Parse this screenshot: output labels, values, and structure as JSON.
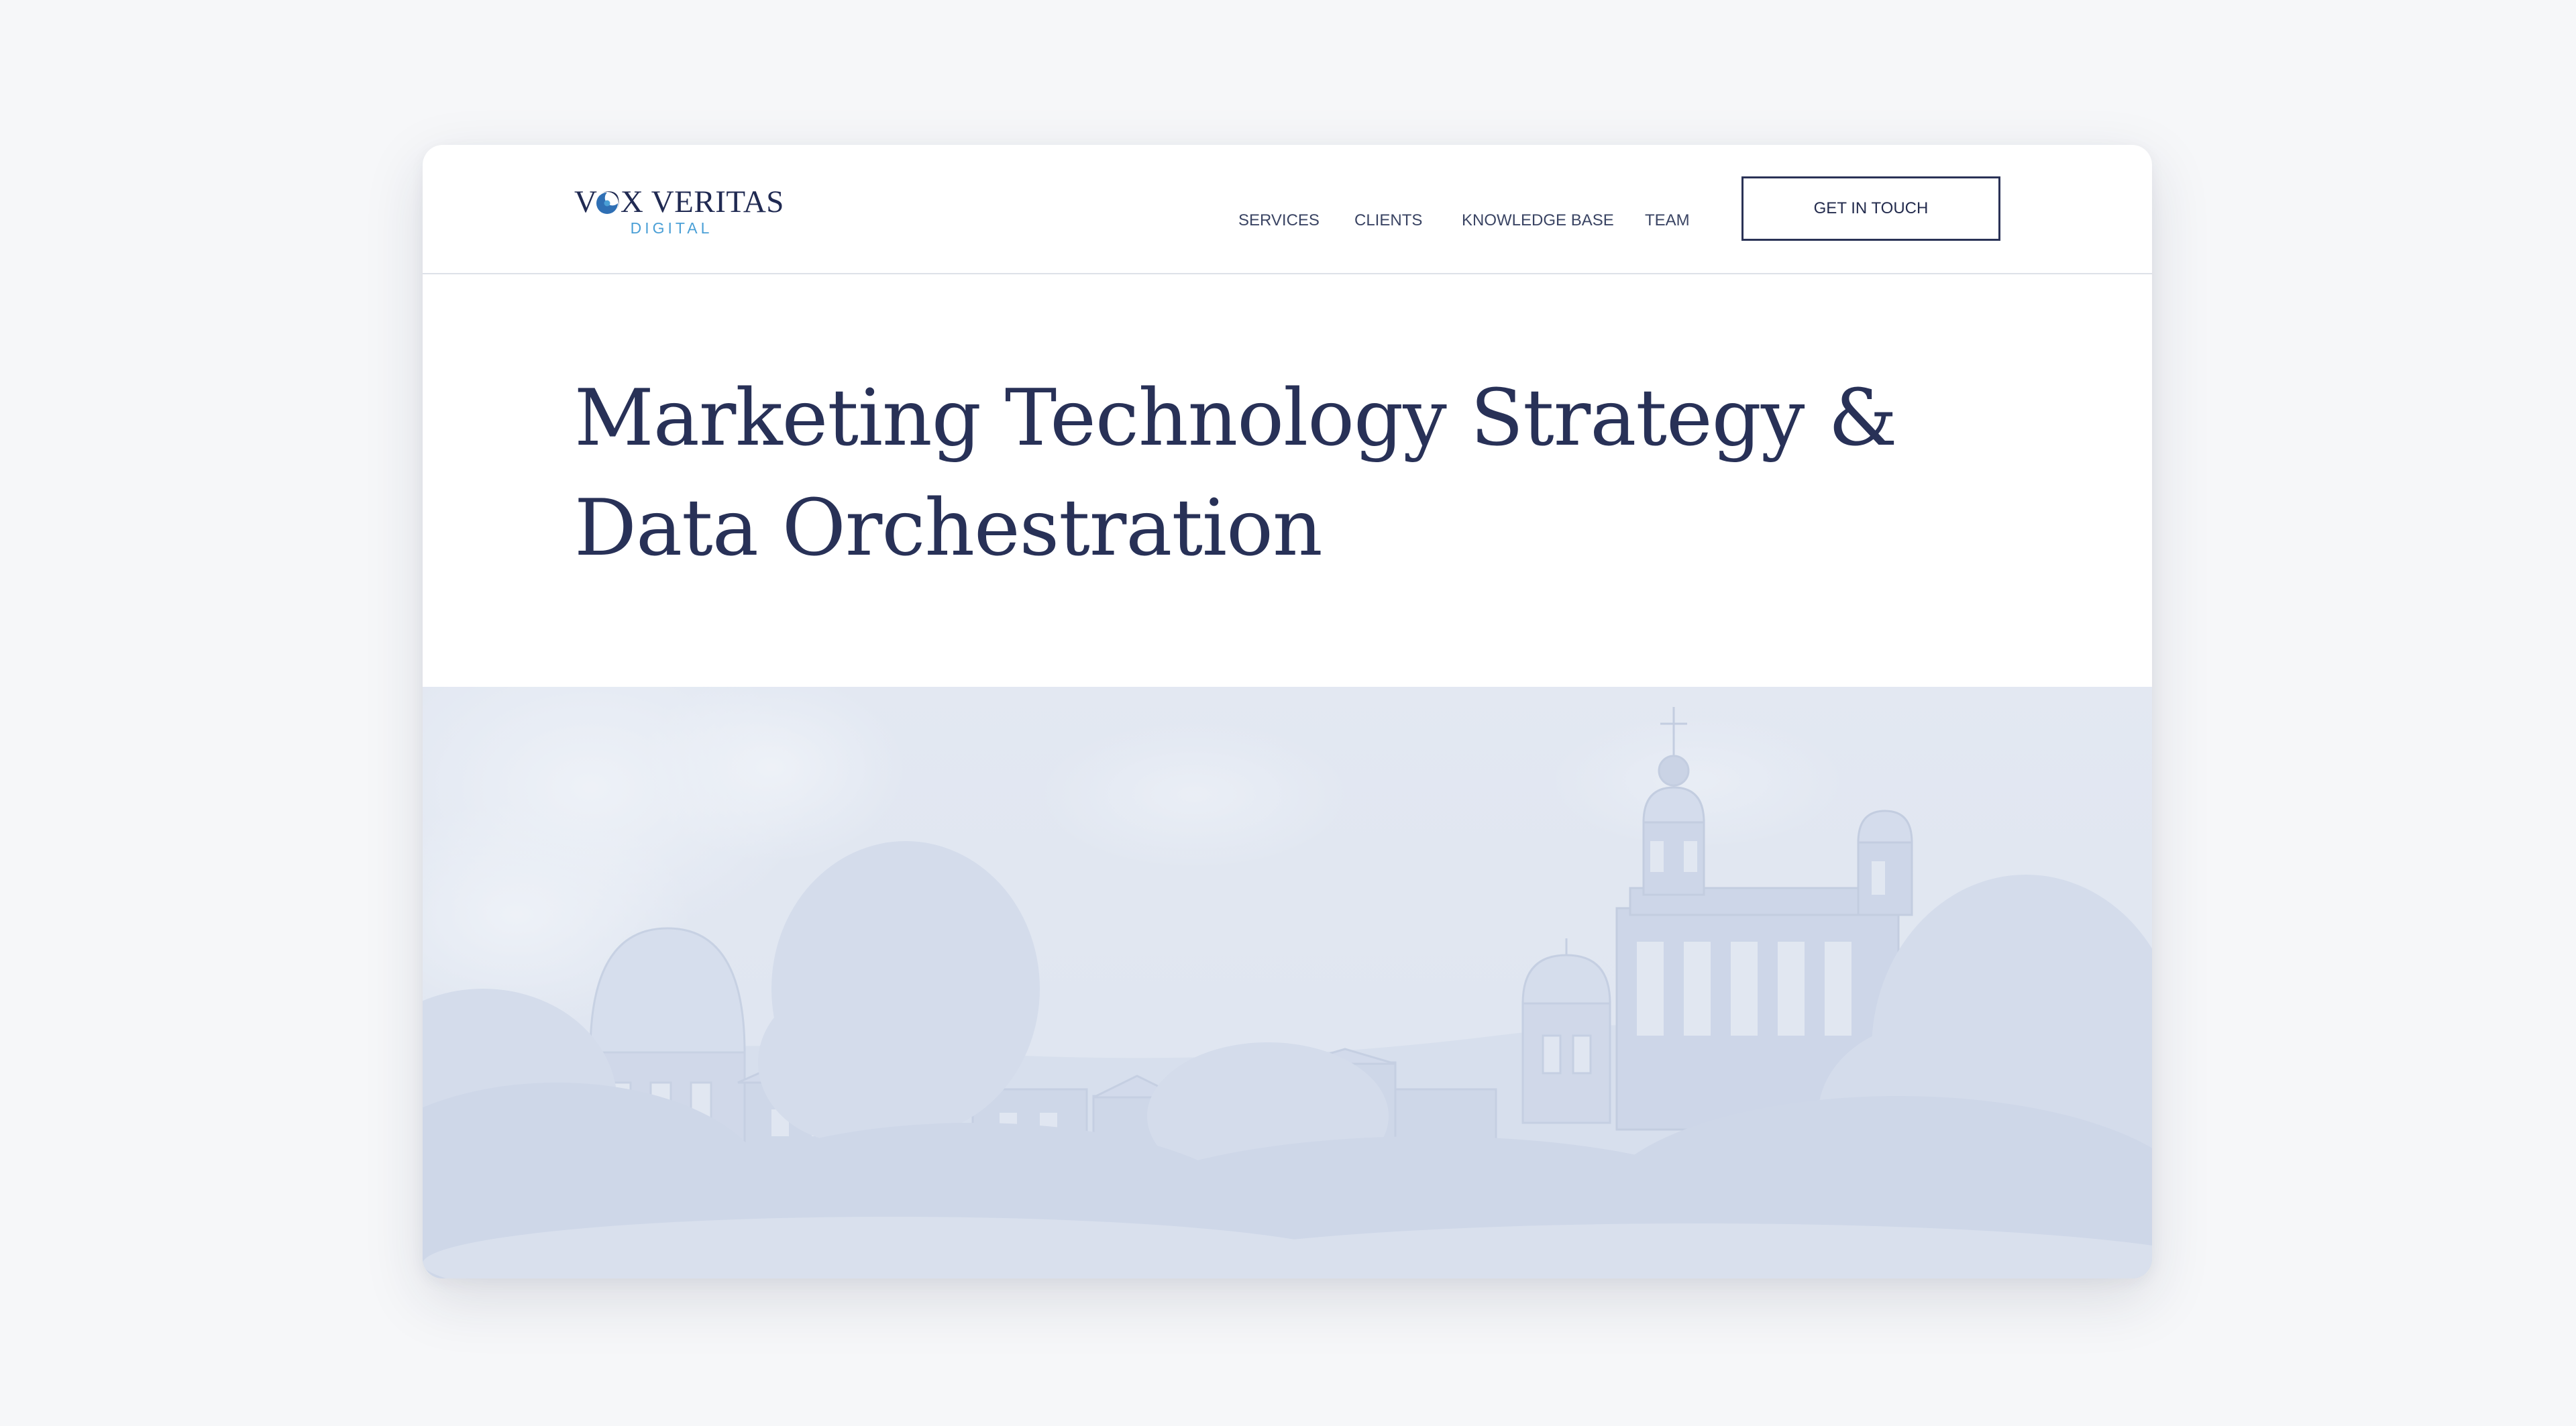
{
  "logo": {
    "wordmark": "VOX VERITAS",
    "subtitle": "DIGITAL"
  },
  "nav": {
    "items": [
      {
        "label": "SERVICES"
      },
      {
        "label": "CLIENTS"
      },
      {
        "label": "KNOWLEDGE BASE"
      },
      {
        "label": "TEAM"
      }
    ],
    "cta_label": "GET IN TOUCH"
  },
  "hero": {
    "title": "Marketing Technology Strategy & Data Orchestration"
  },
  "colors": {
    "navy": "#283157",
    "accent_blue": "#4a9fd6",
    "image_tint": "#d9e0ee"
  }
}
